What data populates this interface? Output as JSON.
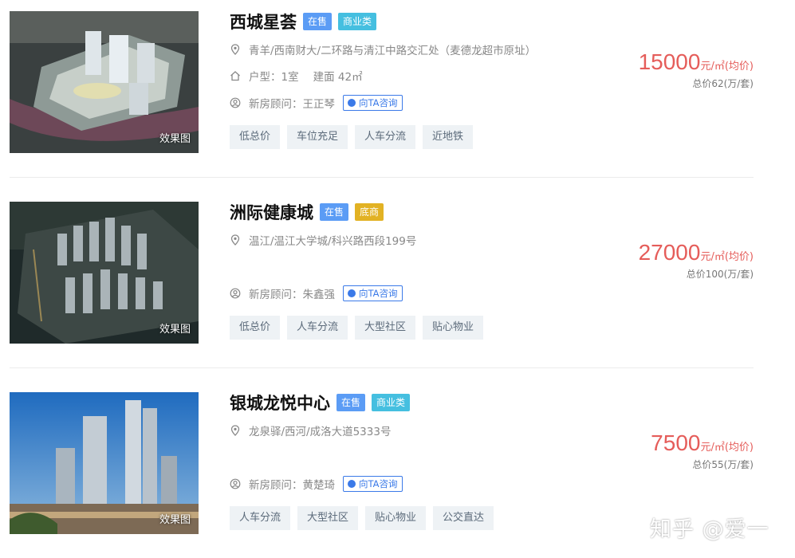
{
  "listings": [
    {
      "title": "西城星荟",
      "badges": [
        "在售",
        "商业类"
      ],
      "address": "青羊/西南财大/二环路与清江中路交汇处（麦德龙超市原址）",
      "layout_label": "户型：1室",
      "area_label": "建面 42㎡",
      "consultant": "新房顾问：王正琴",
      "consult_button": "向TA咨询",
      "tags": [
        "低总价",
        "车位充足",
        "人车分流",
        "近地铁"
      ],
      "price": "15000",
      "price_unit": "元/㎡(均价)",
      "total": "总价62(万/套)",
      "image_caption": "效果图"
    },
    {
      "title": "洲际健康城",
      "badges": [
        "在售",
        "底商"
      ],
      "address": "温江/温江大学城/科兴路西段199号",
      "consultant": "新房顾问：朱鑫强",
      "consult_button": "向TA咨询",
      "tags": [
        "低总价",
        "人车分流",
        "大型社区",
        "贴心物业"
      ],
      "price": "27000",
      "price_unit": "元/㎡(均价)",
      "total": "总价100(万/套)",
      "image_caption": "效果图"
    },
    {
      "title": "银城龙悦中心",
      "badges": [
        "在售",
        "商业类"
      ],
      "address": "龙泉驿/西河/成洛大道5333号",
      "consultant": "新房顾问：黄楚琦",
      "consult_button": "向TA咨询",
      "tags": [
        "人车分流",
        "大型社区",
        "贴心物业",
        "公交直达"
      ],
      "price": "7500",
      "price_unit": "元/㎡(均价)",
      "total": "总价55(万/套)",
      "image_caption": "效果图"
    }
  ],
  "watermark": "知乎 @爱一",
  "colors": {
    "price": "#e55d5a",
    "badge_sale": "#5b9cf5",
    "badge_commercial": "#45bfe0",
    "badge_shop": "#e2b224",
    "consult": "#3b7ae8"
  }
}
